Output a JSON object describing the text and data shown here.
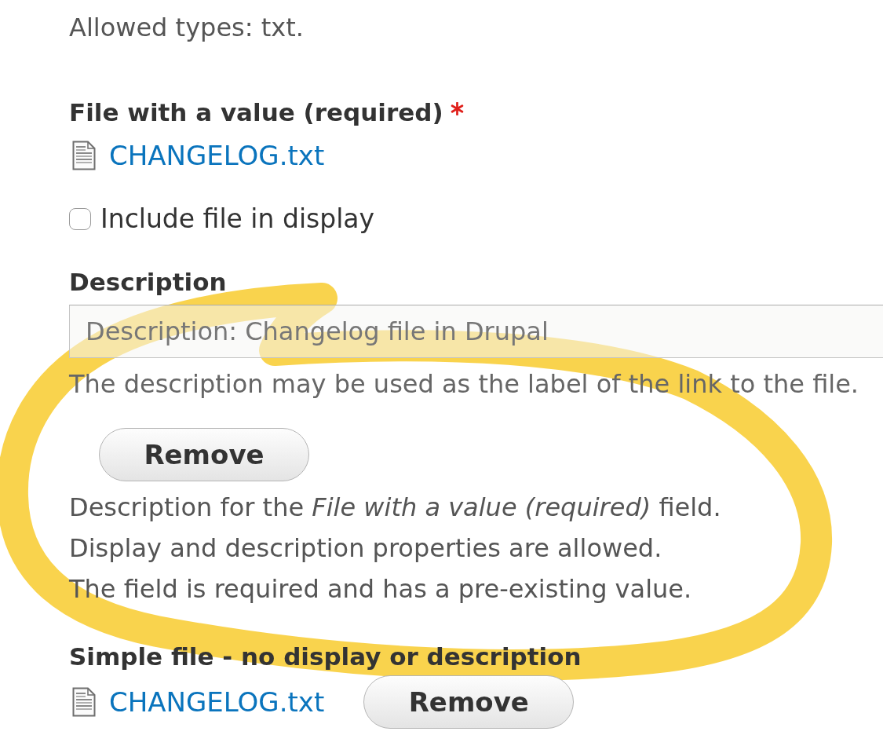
{
  "allowed_types": "Allowed types: txt.",
  "fields": [
    {
      "kind": "detailed",
      "label": "File with a value (required)",
      "required": true,
      "highlighted": true,
      "file": {
        "name": "CHANGELOG.txt"
      },
      "display_checkbox": {
        "label": "Include file in display",
        "checked": false
      },
      "description_field": {
        "label": "Description",
        "value": "Description: Changelog file in Drupal",
        "help": "The description may be used as the label of the link to the file."
      },
      "remove_button": "Remove",
      "notes": [
        "Description for the *File with a value (required)* field.",
        "Display and description properties are allowed.",
        "The field is required and has a pre-existing value."
      ]
    },
    {
      "kind": "simple",
      "label": "Simple file - no display or description",
      "required": false,
      "file": {
        "name": "CHANGELOG.txt"
      },
      "remove_button": "Remove"
    }
  ]
}
